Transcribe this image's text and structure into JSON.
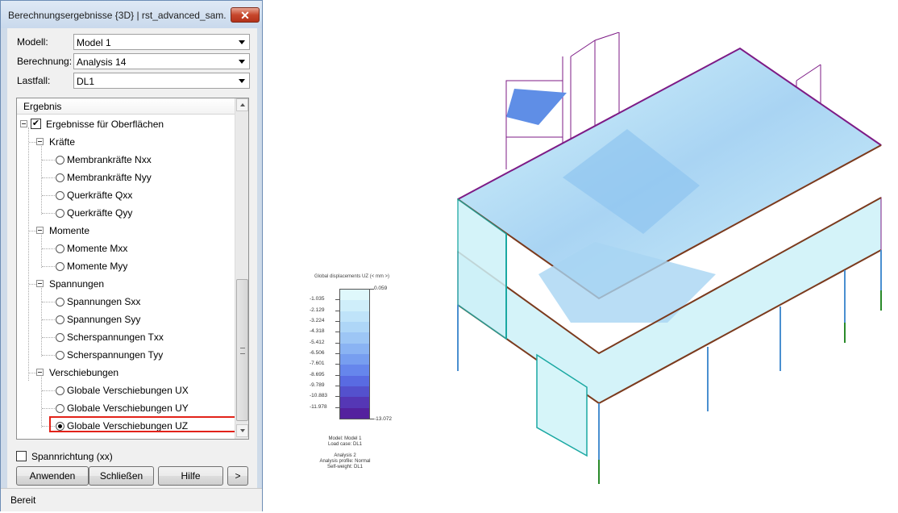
{
  "window": {
    "title": "Berechnungsergebnisse {3D} | rst_advanced_sam...",
    "close_label": "✕"
  },
  "form": {
    "model_label": "Modell:",
    "model_value": "Model 1",
    "calc_label": "Berechnung:",
    "calc_value": "Analysis 14",
    "loadcase_label": "Lastfall:",
    "loadcase_value": "DL1"
  },
  "tree": {
    "header": "Ergebnis",
    "root": "Ergebnisse für Oberflächen",
    "groups": [
      {
        "label": "Kräfte",
        "items": [
          "Membrankräfte Nxx",
          "Membrankräfte Nyy",
          "Querkräfte Qxx",
          "Querkräfte Qyy"
        ]
      },
      {
        "label": "Momente",
        "items": [
          "Momente Mxx",
          "Momente Myy"
        ]
      },
      {
        "label": "Spannungen",
        "items": [
          "Spannungen Sxx",
          "Spannungen Syy",
          "Scherspannungen Txx",
          "Scherspannungen Tyy"
        ]
      },
      {
        "label": "Verschiebungen",
        "items": [
          "Globale Verschiebungen UX",
          "Globale Verschiebungen UY",
          "Globale Verschiebungen UZ"
        ]
      }
    ],
    "selected": "Globale Verschiebungen UZ"
  },
  "options": {
    "spannrichtung_label": "Spannrichtung (xx)"
  },
  "buttons": {
    "apply": "Anwenden",
    "close": "Schließen",
    "help": "Hilfe",
    "more": ">"
  },
  "status": {
    "text": "Bereit"
  },
  "legend": {
    "title": "Global displacements UZ (< mm >)",
    "top_value": "0.059",
    "bottom_value": "-13.072",
    "ticks": [
      "-1.035",
      "-2.129",
      "-3.224",
      "-4.318",
      "-5.412",
      "-6.506",
      "-7.601",
      "-8.695",
      "-9.789",
      "-10.883",
      "-11.978"
    ],
    "colors": [
      "#dff8fb",
      "#cfeefa",
      "#bfe3f9",
      "#aed6f7",
      "#9dc6f5",
      "#8ab3f3",
      "#779ef0",
      "#6686ec",
      "#596be2",
      "#5451cd",
      "#5537b5",
      "#54219e"
    ],
    "info": [
      "Model: Model 1",
      "Load case: DL1",
      "",
      "Analysis 2",
      "Analysis profile: Normal",
      "Self-weight: DL1"
    ]
  }
}
